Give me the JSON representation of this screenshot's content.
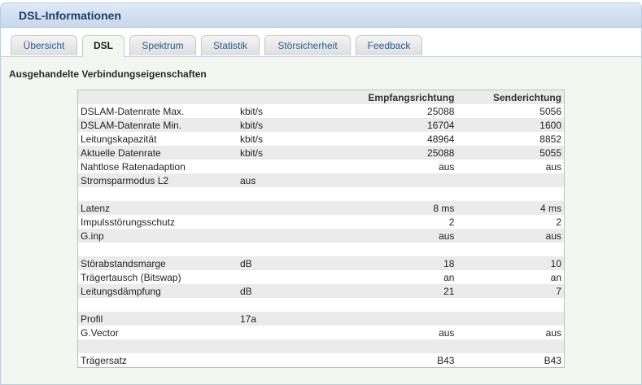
{
  "window": {
    "title": "DSL-Informationen"
  },
  "tabs": [
    {
      "label": "Übersicht",
      "active": false
    },
    {
      "label": "DSL",
      "active": true
    },
    {
      "label": "Spektrum",
      "active": false
    },
    {
      "label": "Statistik",
      "active": false
    },
    {
      "label": "Störsicherheit",
      "active": false
    },
    {
      "label": "Feedback",
      "active": false
    }
  ],
  "section": {
    "title": "Ausgehandelte Verbindungseigenschaften"
  },
  "table": {
    "headers": [
      "",
      "",
      "Empfangsrichtung",
      "Senderichtung"
    ],
    "rows": [
      {
        "label": "DSLAM-Datenrate Max.",
        "unit": "kbit/s",
        "rx": "25088",
        "tx": "5056"
      },
      {
        "label": "DSLAM-Datenrate Min.",
        "unit": "kbit/s",
        "rx": "16704",
        "tx": "1600"
      },
      {
        "label": "Leitungskapazität",
        "unit": "kbit/s",
        "rx": "48964",
        "tx": "8852"
      },
      {
        "label": "Aktuelle Datenrate",
        "unit": "kbit/s",
        "rx": "25088",
        "tx": "5055"
      },
      {
        "label": "Nahtlose Ratenadaption",
        "unit": "",
        "rx": "aus",
        "tx": "aus"
      },
      {
        "label": "Stromsparmodus L2",
        "unit": "aus",
        "rx": "",
        "tx": ""
      },
      {
        "label": "",
        "unit": "",
        "rx": "",
        "tx": ""
      },
      {
        "label": "Latenz",
        "unit": "",
        "rx": "8 ms",
        "tx": "4 ms"
      },
      {
        "label": "Impulsstörungsschutz",
        "unit": "",
        "rx": "2",
        "tx": "2"
      },
      {
        "label": "G.inp",
        "unit": "",
        "rx": "aus",
        "tx": "aus"
      },
      {
        "label": "",
        "unit": "",
        "rx": "",
        "tx": ""
      },
      {
        "label": "Störabstandsmarge",
        "unit": "dB",
        "rx": "18",
        "tx": "10"
      },
      {
        "label": "Trägertausch (Bitswap)",
        "unit": "",
        "rx": "an",
        "tx": "an"
      },
      {
        "label": "Leitungsdämpfung",
        "unit": "dB",
        "rx": "21",
        "tx": "7"
      },
      {
        "label": "",
        "unit": "",
        "rx": "",
        "tx": ""
      },
      {
        "label": "Profil",
        "unit": "17a",
        "rx": "",
        "tx": ""
      },
      {
        "label": "G.Vector",
        "unit": "",
        "rx": "aus",
        "tx": "aus"
      },
      {
        "label": "",
        "unit": "",
        "rx": "",
        "tx": ""
      },
      {
        "label": "Trägersatz",
        "unit": "",
        "rx": "B43",
        "tx": "B43"
      }
    ]
  }
}
